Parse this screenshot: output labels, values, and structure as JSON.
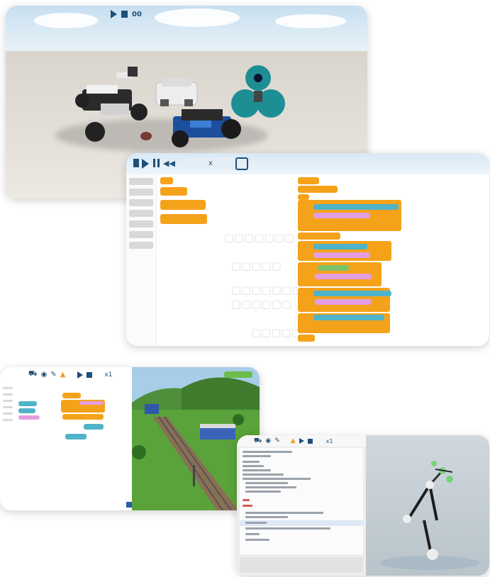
{
  "sim": {
    "toolbar": {
      "icons": [
        "play-icon",
        "stop-icon"
      ],
      "label": "00"
    }
  },
  "editor": {
    "toolbar": {
      "icons": [
        "stop-icon",
        "play-icon",
        "pause-icon",
        "rewind-icon"
      ],
      "label": "x"
    }
  },
  "scene3": {
    "toolbar_label": "x1"
  },
  "scene4": {
    "toolbar_label": "x1"
  }
}
